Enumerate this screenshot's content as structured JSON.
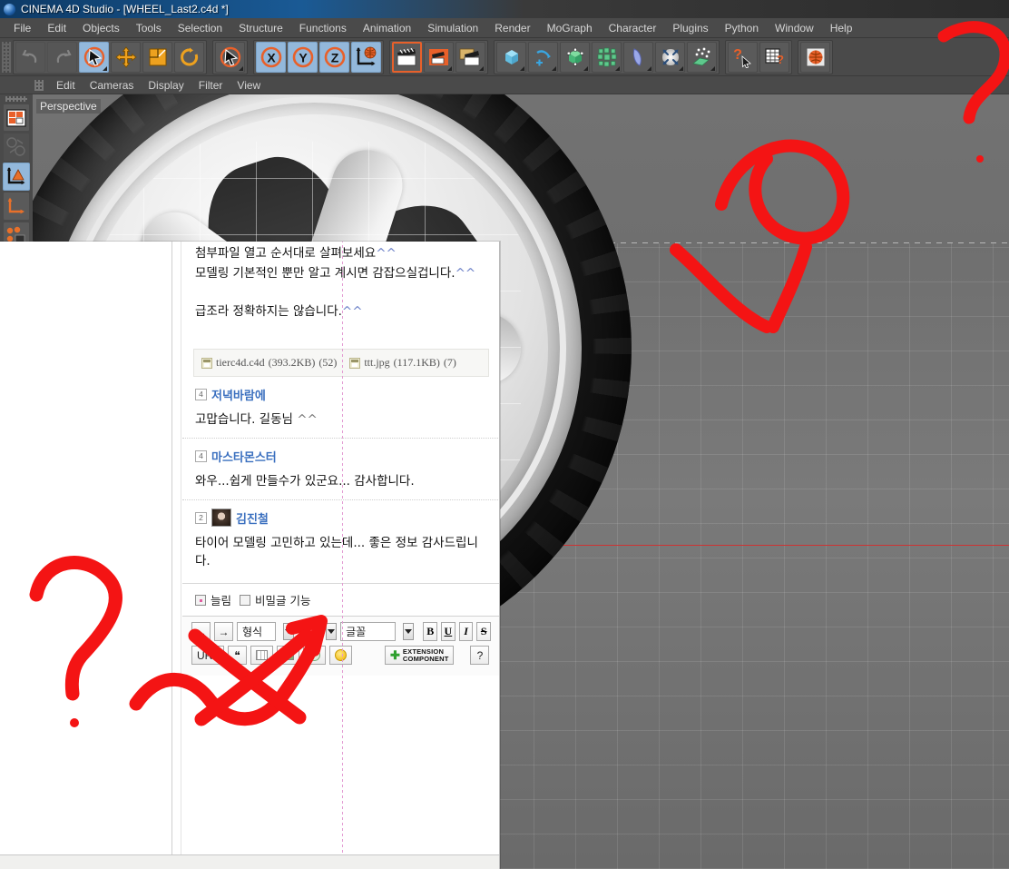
{
  "titlebar": {
    "title": "CINEMA 4D Studio - [WHEEL_Last2.c4d *]",
    "icon": "c4d-logo-icon"
  },
  "menubar": {
    "items": [
      "File",
      "Edit",
      "Objects",
      "Tools",
      "Selection",
      "Structure",
      "Functions",
      "Animation",
      "Simulation",
      "Render",
      "MoGraph",
      "Character",
      "Plugins",
      "Python",
      "Window",
      "Help"
    ]
  },
  "toolbar": {
    "groups": [
      {
        "buttons": [
          {
            "name": "undo-icon",
            "state": "disabled"
          },
          {
            "name": "redo-icon",
            "state": "disabled"
          },
          {
            "name": "live-selection-icon",
            "state": "selected"
          },
          {
            "name": "move-icon",
            "state": "normal"
          },
          {
            "name": "scale-icon",
            "state": "normal"
          },
          {
            "name": "rotate-icon",
            "state": "normal"
          }
        ]
      },
      {
        "buttons": [
          {
            "name": "select-mode-icon",
            "state": "normal"
          }
        ]
      },
      {
        "buttons": [
          {
            "name": "axis-x-lock-icon",
            "state": "selected"
          },
          {
            "name": "axis-y-lock-icon",
            "state": "selected"
          },
          {
            "name": "axis-z-lock-icon",
            "state": "selected"
          },
          {
            "name": "world-object-coordinate-icon",
            "state": "selected"
          }
        ]
      },
      {
        "buttons": [
          {
            "name": "render-view-icon",
            "state": "highlight"
          },
          {
            "name": "render-region-icon",
            "state": "normal"
          },
          {
            "name": "render-settings-icon",
            "state": "normal"
          }
        ]
      },
      {
        "buttons": [
          {
            "name": "cube-primitive-icon",
            "state": "normal"
          },
          {
            "name": "spline-icon",
            "state": "normal"
          },
          {
            "name": "generator-icon",
            "state": "normal"
          },
          {
            "name": "mograph-icon",
            "state": "normal"
          },
          {
            "name": "deformer-icon",
            "state": "normal"
          },
          {
            "name": "environment-icon",
            "state": "normal"
          },
          {
            "name": "particles-icon",
            "state": "normal"
          }
        ]
      },
      {
        "buttons": [
          {
            "name": "help-cursor-icon",
            "state": "normal"
          },
          {
            "name": "help-table-icon",
            "state": "normal"
          }
        ]
      },
      {
        "buttons": [
          {
            "name": "web-browser-icon",
            "state": "normal"
          }
        ]
      }
    ]
  },
  "viewport_menu": {
    "items": [
      "Edit",
      "Cameras",
      "Display",
      "Filter",
      "View"
    ]
  },
  "viewport": {
    "label": "Perspective",
    "rail": [
      {
        "name": "layout-grid-icon",
        "state": "normal"
      },
      {
        "name": "camera-rotate-icon",
        "state": "disabled"
      },
      {
        "name": "axis-object-icon",
        "state": "selected"
      },
      {
        "name": "axis-world-icon",
        "state": "normal"
      },
      {
        "name": "points-mode-icon",
        "state": "normal"
      }
    ]
  },
  "browser": {
    "post": {
      "lines": [
        {
          "text": "첨부파일 열고 순서대로 살펴보세요",
          "squiggle": "^^"
        },
        {
          "text": "모델링 기본적인 뿐만 알고 계시면 감잡으실겁니다.",
          "squiggle": "^^"
        },
        {
          "text": "",
          "squiggle": ""
        },
        {
          "text": "급조라 정확하지는 않습니다.",
          "squiggle": "^^"
        }
      ],
      "attachments": [
        {
          "icon": "file-icon",
          "name": "tierc4d.c4d",
          "size": "(393.2KB)",
          "count": "(52)"
        },
        {
          "icon": "file-icon",
          "name": "ttt.jpg",
          "size": "(117.1KB)",
          "count": "(7)"
        }
      ]
    },
    "comments": [
      {
        "badge": "4",
        "avatar": false,
        "author": "저녁바람에",
        "text": "고맙습니다. 길동님 ",
        "squiggle": "^^"
      },
      {
        "badge": "4",
        "avatar": false,
        "author": "마스타몬스터",
        "text": "와우...쉽게 만들수가 있군요... 감사합니다.",
        "squiggle": ""
      },
      {
        "badge": "2",
        "avatar": true,
        "author": "김진철",
        "text": "타이어 모델링 고민하고 있는데... 좋은 정보 감사드립니다.",
        "squiggle": ""
      }
    ],
    "options": [
      {
        "name": "option-checkbox-1",
        "label": "늘림",
        "checked": true
      },
      {
        "name": "option-checkbox-secret",
        "label": "비밀글 기능",
        "checked": false
      }
    ],
    "editor_toolbar": {
      "row1": {
        "back_label": "←",
        "forward_label": "→",
        "format_select": "형식",
        "size_select": "크기",
        "font_select": "글꼴",
        "bold": "B",
        "underline": "U",
        "italic": "I",
        "strike": "S"
      },
      "row2": {
        "url_label": "URL",
        "quote_label": "❝",
        "table_icon": "table-icon",
        "image_icon": "image-icon",
        "video_icon": "video-icon",
        "emoticon_icon": "emoticon-icon",
        "extension_line1": "EXTENSION",
        "extension_line2": "COMPONENT",
        "help_label": "?"
      }
    }
  },
  "annotations": {
    "color": "#f41414",
    "marks": [
      "question-mark-top-right",
      "arrow-curve-to-wheel",
      "question-mark-bottom-left",
      "arrow-to-editor-toolbar"
    ]
  }
}
